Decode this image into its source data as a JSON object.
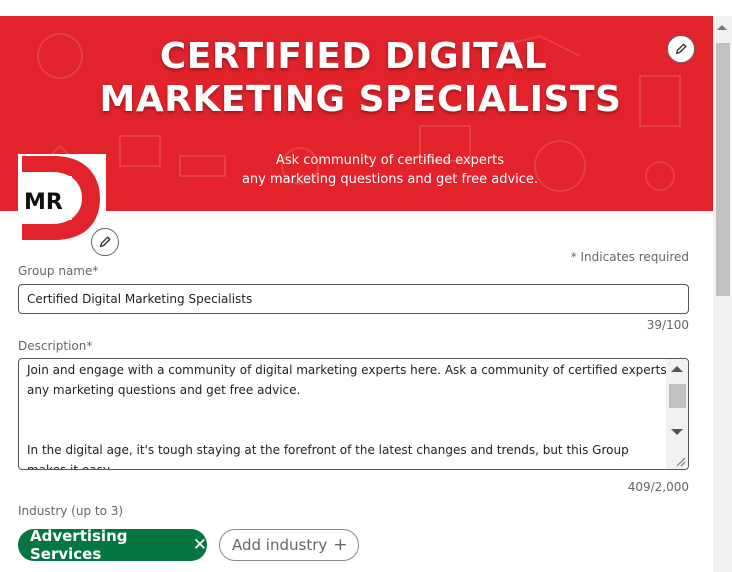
{
  "banner": {
    "title_line1": "CERTIFIED DIGITAL",
    "title_line2": "MARKETING SPECIALISTS",
    "subtitle_line1": "Ask community of certified  experts",
    "subtitle_line2": "any marketing questions and get free advice.",
    "background_color": "#e2232b"
  },
  "logo": {
    "text": "MR"
  },
  "form": {
    "required_note": "* Indicates required",
    "group_name": {
      "label": "Group name*",
      "value": "Certified Digital Marketing Specialists",
      "counter": "39/100"
    },
    "description": {
      "label": "Description*",
      "paragraph1": "Join and engage with a community of digital marketing experts here. Ask a community of certified experts any marketing questions and get free advice.",
      "paragraph2": "In the digital age, it's tough staying at the forefront of the latest changes and trends, but this Group makes it easy.",
      "counter": "409/2,000"
    },
    "industry": {
      "label": "Industry (up to 3)",
      "selected": [
        {
          "label": "Advertising Services",
          "remove_icon": "close-icon"
        }
      ],
      "add_label": "Add industry",
      "add_icon": "plus-icon",
      "chip_color": "#057642"
    }
  },
  "icons": {
    "edit": "pencil-icon"
  }
}
